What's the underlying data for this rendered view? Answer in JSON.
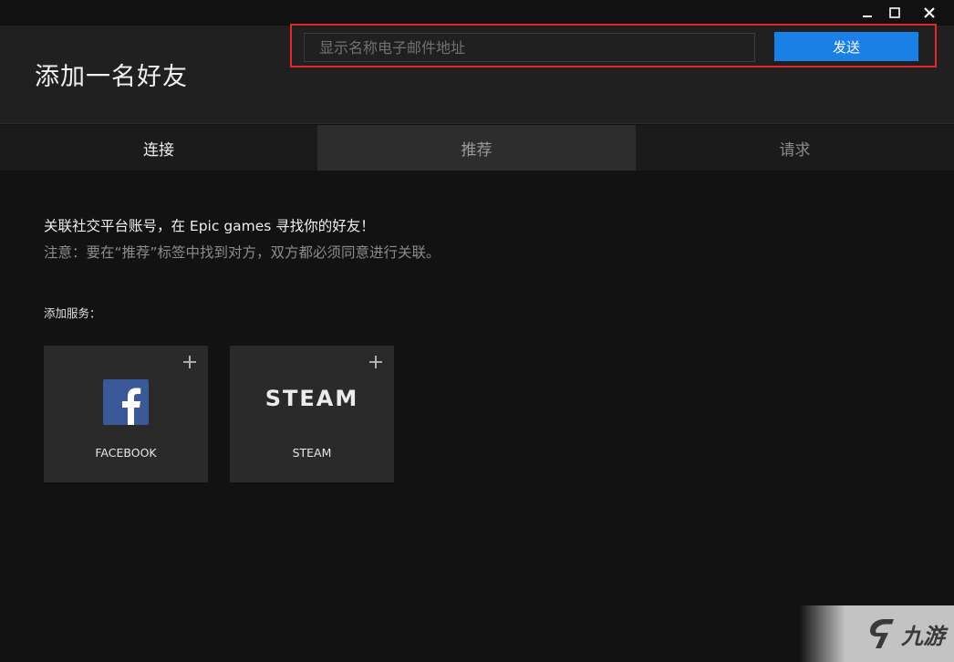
{
  "window": {
    "controls": [
      "minimize-icon",
      "maximize-icon",
      "close-icon"
    ]
  },
  "header": {
    "title": "添加一名好友",
    "search": {
      "placeholder": "显示名称电子邮件地址",
      "value": ""
    },
    "send_label": "发送",
    "highlight_color": "#e0282e",
    "accent_color": "#1a7fe6"
  },
  "tabs": [
    {
      "label": "连接"
    },
    {
      "label": "推荐"
    },
    {
      "label": "请求"
    }
  ],
  "content": {
    "intro": "关联社交平台账号，在 Epic games 寻找你的好友！",
    "note": "注意：要在“推荐”标签中找到对方，双方都必须同意进行关联。",
    "services_label": "添加服务：",
    "services": [
      {
        "name": "FACEBOOK",
        "icon": "facebook-logo-icon"
      },
      {
        "name": "STEAM",
        "logo_text": "STEAM",
        "icon": "steam-wordmark"
      }
    ]
  },
  "watermark": {
    "text": "九游"
  }
}
